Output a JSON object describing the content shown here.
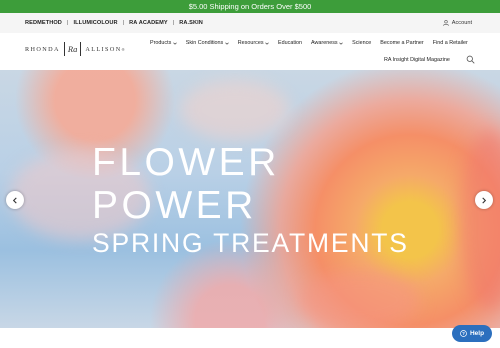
{
  "promo": {
    "text": "$5.00 Shipping on Orders Over $500"
  },
  "utility_links": [
    "REDMETHOD",
    "ILLUMICOLOUR",
    "RA ACADEMY",
    "RA.SKIN"
  ],
  "utility_separator": "|",
  "account": {
    "label": "Account",
    "icon": "user-icon"
  },
  "logo": {
    "left": "RHONDA",
    "mark": "Ra",
    "right": "ALLISON",
    "trademark": "®"
  },
  "nav": {
    "row1": [
      {
        "label": "Products",
        "dropdown": true
      },
      {
        "label": "Skin Conditions",
        "dropdown": true
      },
      {
        "label": "Resources",
        "dropdown": true
      },
      {
        "label": "Education",
        "dropdown": false
      },
      {
        "label": "Awareness",
        "dropdown": true
      },
      {
        "label": "Science",
        "dropdown": false
      },
      {
        "label": "Become a Partner",
        "dropdown": false
      },
      {
        "label": "Find a Retailer",
        "dropdown": false
      }
    ],
    "row2": [
      {
        "label": "RA Insight Digital Magazine",
        "dropdown": false
      }
    ],
    "search_icon": "search-icon"
  },
  "hero": {
    "line1": "FLOWER",
    "line2": "POWER",
    "line3": "SPRING TREATMENTS"
  },
  "carousel": {
    "prev_icon": "chevron-left-icon",
    "next_icon": "chevron-right-icon"
  },
  "help": {
    "label": "Help",
    "icon": "help-icon"
  },
  "colors": {
    "promo_green": "#3d9d3a",
    "help_blue": "#2b6fbe"
  }
}
